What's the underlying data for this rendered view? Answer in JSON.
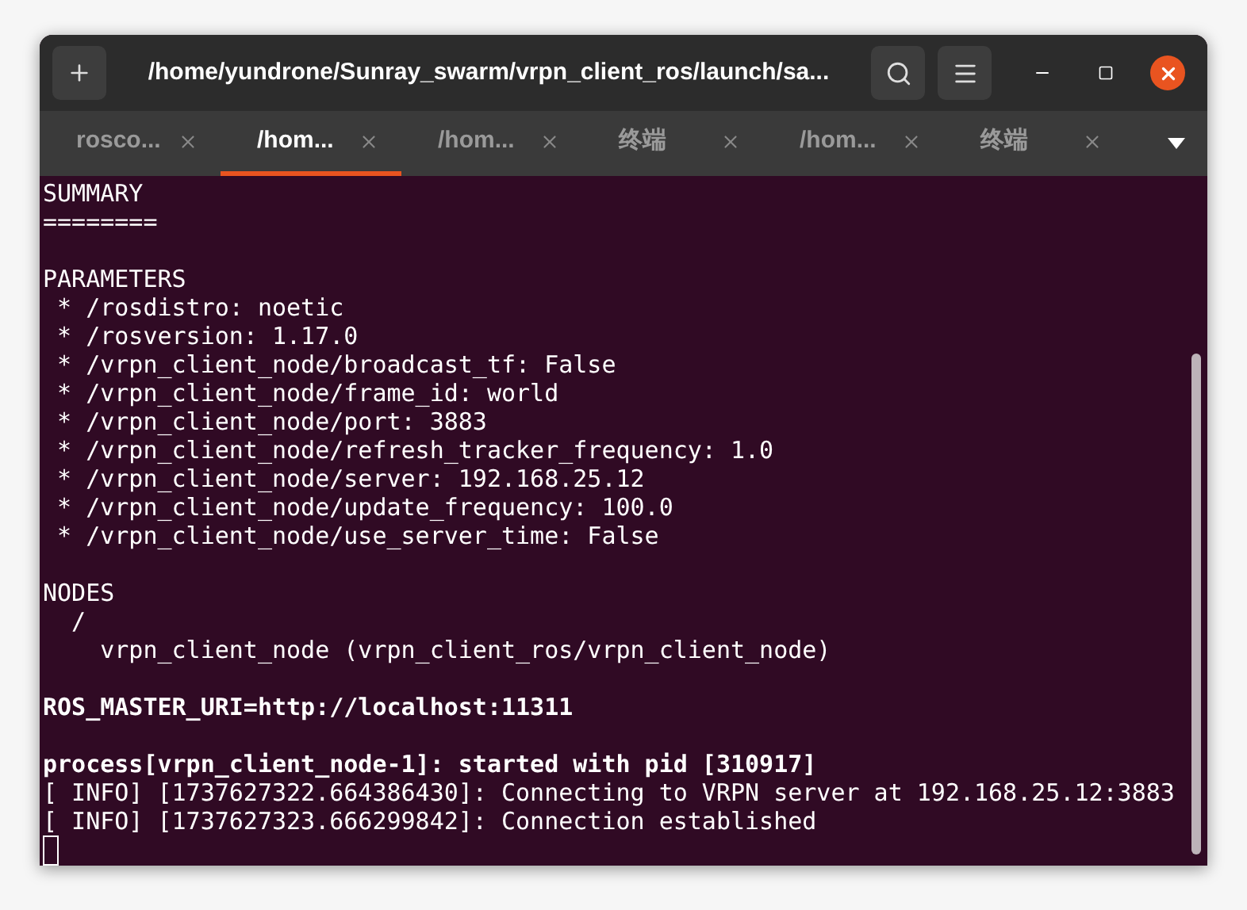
{
  "window": {
    "title": "/home/yundrone/Sunray_swarm/vrpn_client_ros/launch/sa..."
  },
  "tabs": [
    {
      "label": "rosco...",
      "selected": false
    },
    {
      "label": "/hom...",
      "selected": true
    },
    {
      "label": "/hom...",
      "selected": false
    },
    {
      "label": "终端",
      "selected": false
    },
    {
      "label": "/hom...",
      "selected": false
    },
    {
      "label": "终端",
      "selected": false
    }
  ],
  "terminal": {
    "lines": [
      {
        "kind": "text",
        "text": "SUMMARY"
      },
      {
        "kind": "text",
        "text": "========"
      },
      {
        "kind": "blank"
      },
      {
        "kind": "text",
        "text": "PARAMETERS"
      },
      {
        "kind": "text",
        "text": " * /rosdistro: noetic"
      },
      {
        "kind": "text",
        "text": " * /rosversion: 1.17.0"
      },
      {
        "kind": "text",
        "text": " * /vrpn_client_node/broadcast_tf: False"
      },
      {
        "kind": "text",
        "text": " * /vrpn_client_node/frame_id: world"
      },
      {
        "kind": "text",
        "text": " * /vrpn_client_node/port: 3883"
      },
      {
        "kind": "text",
        "text": " * /vrpn_client_node/refresh_tracker_frequency: 1.0"
      },
      {
        "kind": "text",
        "text": " * /vrpn_client_node/server: 192.168.25.12"
      },
      {
        "kind": "text",
        "text": " * /vrpn_client_node/update_frequency: 100.0"
      },
      {
        "kind": "text",
        "text": " * /vrpn_client_node/use_server_time: False"
      },
      {
        "kind": "blank"
      },
      {
        "kind": "text",
        "text": "NODES"
      },
      {
        "kind": "text",
        "text": "  /"
      },
      {
        "kind": "text",
        "text": "    vrpn_client_node (vrpn_client_ros/vrpn_client_node)"
      },
      {
        "kind": "blank"
      },
      {
        "kind": "bold",
        "text": "ROS_MASTER_URI=http://localhost:11311"
      },
      {
        "kind": "blank"
      },
      {
        "kind": "bold",
        "text": "process[vrpn_client_node-1]: started with pid [310917]"
      },
      {
        "kind": "text",
        "text": "[ INFO] [1737627322.664386430]: Connecting to VRPN server at 192.168.25.12:3883"
      },
      {
        "kind": "text",
        "text": "[ INFO] [1737627323.666299842]: Connection established"
      }
    ]
  }
}
